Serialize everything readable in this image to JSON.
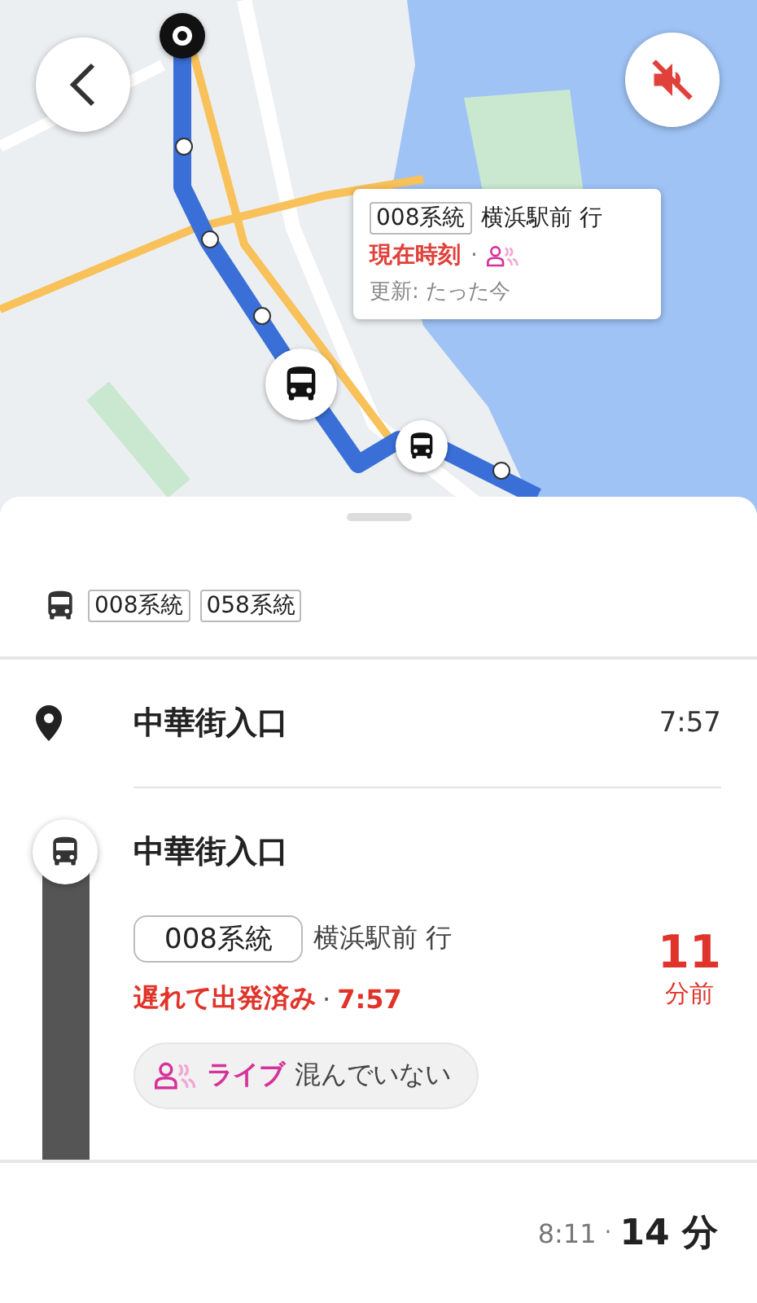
{
  "callout": {
    "route": "008系統",
    "destination": "横浜駅前 行",
    "status": "現在時刻",
    "separator": "·",
    "updated": "更新: たった今"
  },
  "routes": [
    "008系統",
    "058系統"
  ],
  "stops": [
    {
      "kind": "pin",
      "name": "中華街入口",
      "time": "7:57"
    },
    {
      "kind": "bus",
      "name": "中華街入口"
    }
  ],
  "departure": {
    "route": "008系統",
    "destination": "横浜駅前 行",
    "status": "遅れて出発済み",
    "separator": "·",
    "time": "7:57",
    "minutes": "11",
    "minutes_unit": "分前",
    "crowd_label": "ライブ",
    "crowd_text": "混んでいない"
  },
  "footer": {
    "arrival": "8:11",
    "separator": "·",
    "duration": "14 分"
  }
}
